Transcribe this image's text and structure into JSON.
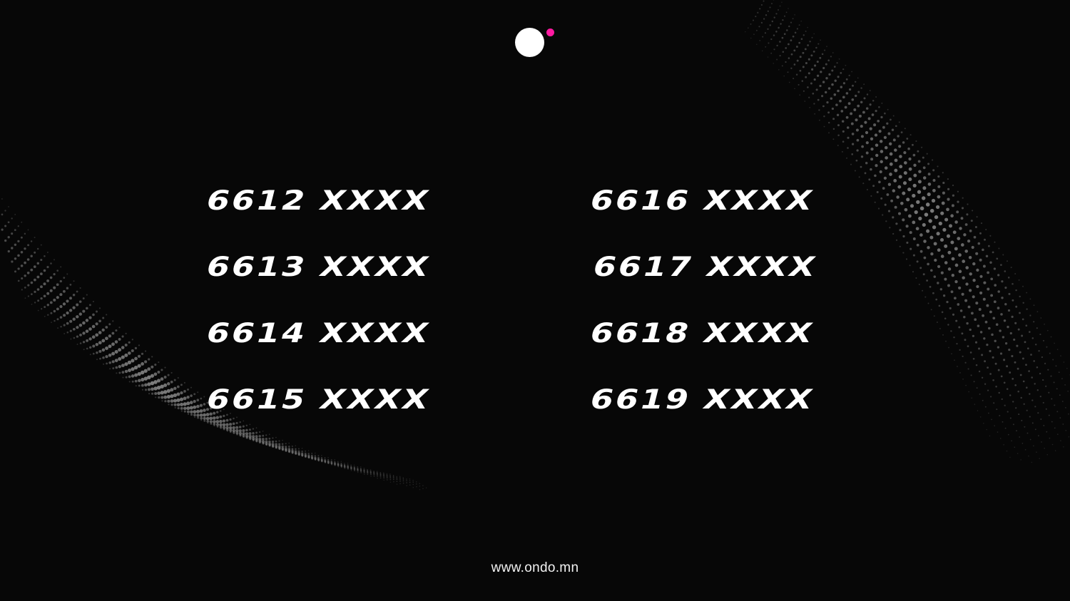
{
  "logo": {
    "icon": "ondo-dots-logo",
    "main_dot_color": "#ffffff",
    "accent_dot_color": "#ff1aa1"
  },
  "numbers": {
    "left": [
      "6612 XXXX",
      "6613 XXXX",
      "6614 XXXX",
      "6615 XXXX"
    ],
    "right": [
      "6616 XXXX",
      "6617 XXXX",
      "6618 XXXX",
      "6619 XXXX"
    ]
  },
  "footer": {
    "url": "www.ondo.mn"
  },
  "colors": {
    "background": "#070707",
    "text": "#ffffff",
    "wave_dots": "#8a8a8a"
  }
}
